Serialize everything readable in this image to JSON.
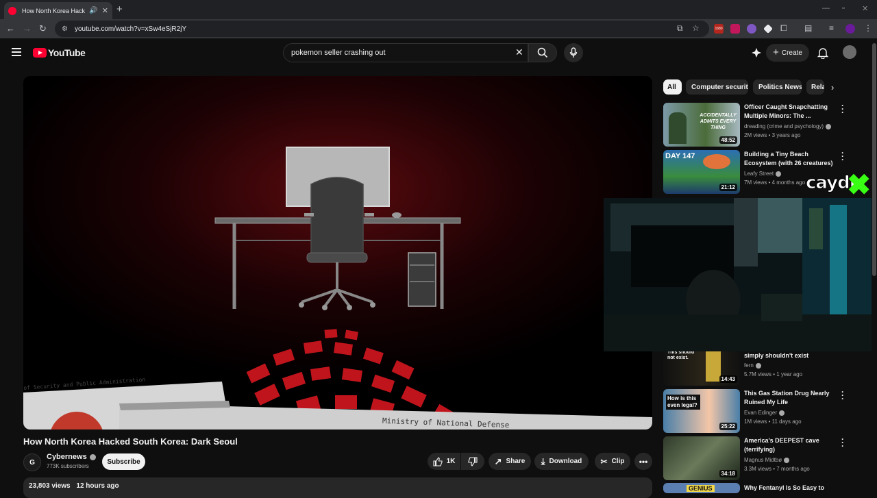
{
  "browser": {
    "tab_title": "How North Korea Hacked S",
    "url": "youtube.com/watch?v=xSw4eSjR2jY",
    "ext_badge": "1680"
  },
  "masthead": {
    "logo_text": "YouTube",
    "search_value": "pokemon seller crashing out",
    "create_label": "Create"
  },
  "video": {
    "title": "How North Korea Hacked South Korea: Dark Seoul",
    "channel": "Cybernews",
    "channel_initial": "G",
    "subscribers": "773K subscribers",
    "subscribe_label": "Subscribe",
    "likes": "1K",
    "share_label": "Share",
    "download_label": "Download",
    "clip_label": "Clip",
    "views": "23,803 views",
    "age": "12 hours ago",
    "frame_doc_text": "of Security and Public Administration",
    "frame_ministry_text": "Ministry of National Defense"
  },
  "chips": [
    "All",
    "Computer security",
    "Politics News",
    "Rela"
  ],
  "recommendations": [
    {
      "title": "Officer Caught Snapchatting Multiple Minors: The ...",
      "channel": "dreading (crime and psychology)",
      "views": "2M views",
      "age": "3 years ago",
      "duration": "48:52",
      "thumb_text": "ACCIDENTALLY ADMITS EVERY THING"
    },
    {
      "title": "Building a Tiny Beach Ecosystem (with 26 creatures)",
      "channel": "Leafy Street",
      "views": "7M views",
      "age": "4 months ago",
      "duration": "21:12",
      "thumb_text": "DAY 147"
    },
    {
      "title": "simply shouldn't exist",
      "channel": "fern",
      "views": "5.7M views",
      "age": "1 year ago",
      "duration": "14:43",
      "thumb_text": "This should not exist."
    },
    {
      "title": "This Gas Station Drug Nearly Ruined My Life",
      "channel": "Evan Edinger",
      "views": "1M views",
      "age": "11 days ago",
      "duration": "25:22",
      "thumb_text": "How is this even legal?"
    },
    {
      "title": "America's DEEPEST cave (terrifying)",
      "channel": "Magnus Midtbø",
      "views": "3.3M views",
      "age": "7 months ago",
      "duration": "34:18",
      "thumb_text": ""
    },
    {
      "title": "Why Fentanyl Is So Easy to",
      "channel": "",
      "views": "",
      "age": "",
      "duration": "",
      "thumb_text": "GENIUS"
    }
  ],
  "overlay": {
    "logo_text": "caydr"
  },
  "colors": {
    "yt_red": "#ff0033",
    "bg": "#0f0f0f",
    "chip_bg": "#272727",
    "overlay_green": "#39ff14"
  }
}
